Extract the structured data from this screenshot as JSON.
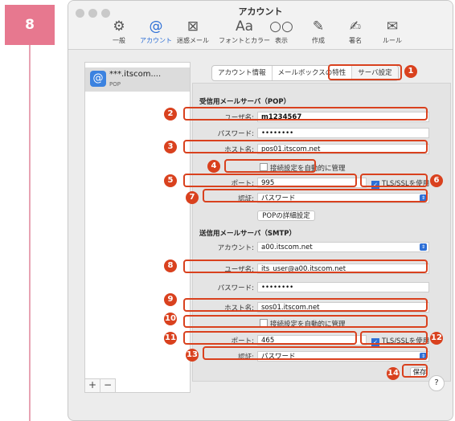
{
  "step_number": "8",
  "window": {
    "title": "アカウント"
  },
  "toolbar": [
    {
      "label": "一般",
      "icon": "⚙",
      "icon_name": "gear-icon"
    },
    {
      "label": "アカウント",
      "icon": "@",
      "icon_name": "at-icon",
      "active": true
    },
    {
      "label": "迷惑メール",
      "icon": "⊠",
      "icon_name": "junk-mail-icon"
    },
    {
      "label": "フォントとカラー",
      "icon": "Aa",
      "icon_name": "font-icon"
    },
    {
      "label": "表示",
      "icon": "○○",
      "icon_name": "glasses-icon"
    },
    {
      "label": "作成",
      "icon": "✎",
      "icon_name": "compose-icon"
    },
    {
      "label": "署名",
      "icon": "✍",
      "icon_name": "signature-icon"
    },
    {
      "label": "ルール",
      "icon": "✉",
      "icon_name": "rules-icon"
    }
  ],
  "sidebar": {
    "account_name": "***.itscom....",
    "account_type": "POP",
    "add_label": "+",
    "remove_label": "−"
  },
  "tabs": [
    "アカウント情報",
    "メールボックスの特性",
    "サーバ設定"
  ],
  "incoming": {
    "heading": "受信用メールサーバ（POP）",
    "username_label": "ユーザ名:",
    "username": "m1234567",
    "password_label": "パスワード:",
    "password": "••••••••",
    "host_label": "ホスト名:",
    "host": "pos01.itscom.net",
    "auto_manage_label": "接続設定を自動的に管理",
    "port_label": "ポート:",
    "port": "995",
    "tls_label": "TLS/SSLを使用",
    "auth_label": "認証:",
    "auth_value": "パスワード",
    "advanced_button": "POPの詳細設定"
  },
  "outgoing": {
    "heading": "送信用メールサーバ（SMTP）",
    "account_label": "アカウント:",
    "account_value": "a00.itscom.net",
    "username_label": "ユーザ名:",
    "username": "its_user@a00.itscom.net",
    "password_label": "パスワード:",
    "password": "••••••••",
    "host_label": "ホスト名:",
    "host": "sos01.itscom.net",
    "auto_manage_label": "接続設定を自動的に管理",
    "port_label": "ポート:",
    "port": "465",
    "tls_label": "TLS/SSLを使用",
    "auth_label": "認証:",
    "auth_value": "パスワード",
    "save_button": "保存"
  },
  "markers": [
    "1",
    "2",
    "3",
    "4",
    "5",
    "6",
    "7",
    "8",
    "9",
    "10",
    "11",
    "12",
    "13",
    "14"
  ],
  "help_label": "?",
  "colors": {
    "highlight": "#d9411e",
    "accent": "#2d6fd6",
    "step_badge": "#e7788f"
  }
}
